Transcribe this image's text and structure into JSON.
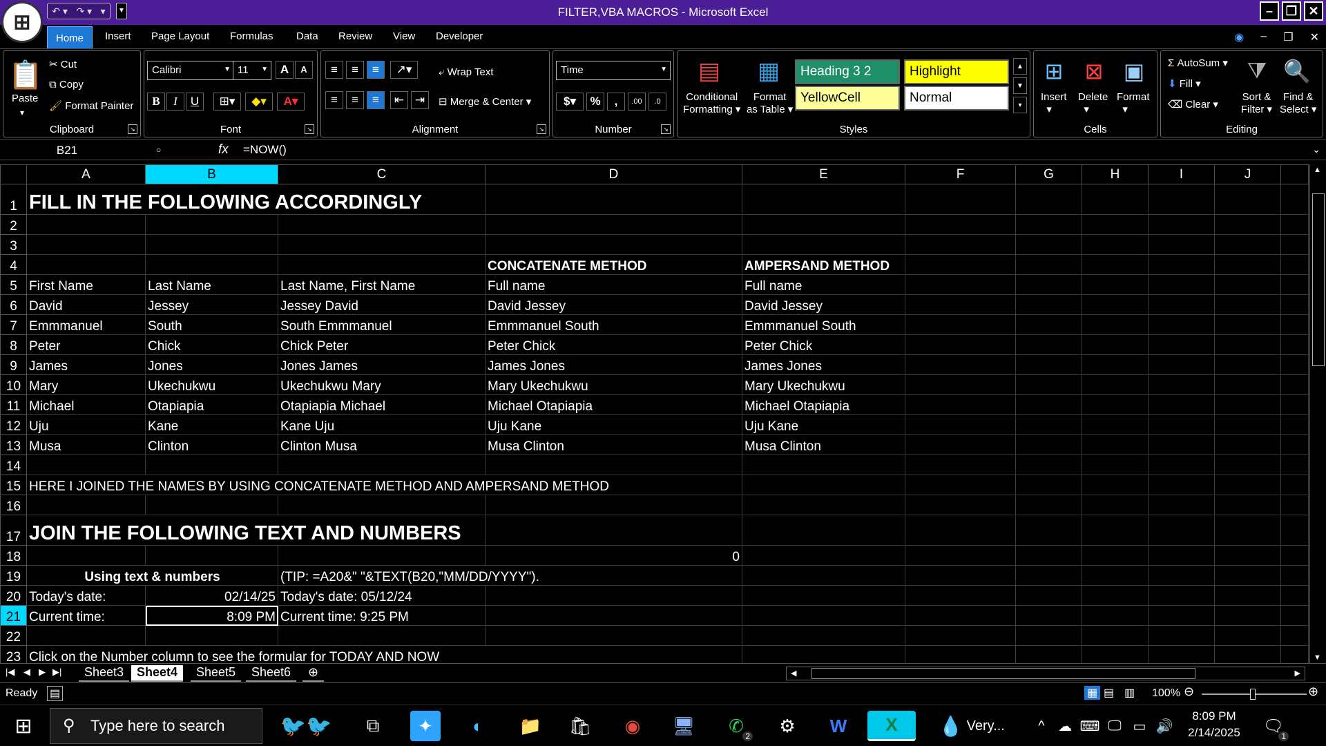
{
  "window": {
    "title": "FILTER,VBA MACROS - Microsoft Excel",
    "controls": [
      "minimize",
      "restore",
      "close"
    ]
  },
  "ribbon_tabs": [
    "Home",
    "Insert",
    "Page Layout",
    "Formulas",
    "Data",
    "Review",
    "View",
    "Developer"
  ],
  "active_tab": "Home",
  "clipboard": {
    "paste": "Paste",
    "cut": "Cut",
    "copy": "Copy",
    "format_painter": "Format Painter",
    "label": "Clipboard"
  },
  "font": {
    "name": "Calibri",
    "size": "11",
    "label": "Font"
  },
  "alignment": {
    "wrap_text": "Wrap Text",
    "merge_center": "Merge & Center",
    "label": "Alignment"
  },
  "number": {
    "format": "Time",
    "label": "Number"
  },
  "styles": {
    "conditional_formatting_1": "Conditional",
    "conditional_formatting_2": "Formatting",
    "format_as_table_1": "Format",
    "format_as_table_2": "as Table",
    "gallery": [
      {
        "name": "Heading 3 2",
        "bg": "#1f8f6a",
        "fg": "#ffffff"
      },
      {
        "name": "Highlight",
        "bg": "#ffff00",
        "fg": "#000000"
      },
      {
        "name": "YellowCell",
        "bg": "#ffff99",
        "fg": "#000000"
      },
      {
        "name": "Normal",
        "bg": "#ffffff",
        "fg": "#000000"
      }
    ],
    "label": "Styles"
  },
  "cells": {
    "insert": "Insert",
    "delete": "Delete",
    "format": "Format",
    "label": "Cells"
  },
  "editing": {
    "autosum": "AutoSum",
    "fill": "Fill",
    "clear": "Clear",
    "sort_filter_1": "Sort &",
    "sort_filter_2": "Filter",
    "find_select_1": "Find &",
    "find_select_2": "Select",
    "label": "Editing"
  },
  "formula_bar": {
    "name_box": "B21",
    "fx": "fx",
    "formula": "=NOW()"
  },
  "columns": [
    "A",
    "B",
    "C",
    "D",
    "E",
    "F",
    "G",
    "H",
    "I",
    "J"
  ],
  "selected_column": "B",
  "selected_row": "21",
  "rows": [
    {
      "n": "1",
      "big": true,
      "A": "FILL IN THE FOLLOWING ACCORDINGLY"
    },
    {
      "n": "2"
    },
    {
      "n": "3"
    },
    {
      "n": "4",
      "D": "CONCATENATE METHOD",
      "E": "AMPERSAND METHOD",
      "bold_de": true
    },
    {
      "n": "5",
      "A": "First Name",
      "B": "Last Name",
      "C": "Last Name, First Name",
      "D": "Full name",
      "E": "Full name"
    },
    {
      "n": "6",
      "A": "David",
      "B": "Jessey",
      "C": "Jessey David",
      "D": "David Jessey",
      "E": "David Jessey"
    },
    {
      "n": "7",
      "A": "Emmmanuel",
      "B": "South",
      "C": "South Emmmanuel",
      "D": "Emmmanuel South",
      "E": "Emmmanuel South"
    },
    {
      "n": "8",
      "A": "Peter",
      "B": "Chick",
      "C": "Chick Peter",
      "D": "Peter Chick",
      "E": "Peter Chick"
    },
    {
      "n": "9",
      "A": "James",
      "B": "Jones",
      "C": "Jones James",
      "D": "James Jones",
      "E": "James Jones"
    },
    {
      "n": "10",
      "A": "Mary",
      "B": "Ukechukwu",
      "C": "Ukechukwu Mary",
      "D": "Mary Ukechukwu",
      "E": "Mary Ukechukwu"
    },
    {
      "n": "11",
      "A": "Michael",
      "B": "Otapiapia",
      "C": "Otapiapia Michael",
      "D": "Michael Otapiapia",
      "E": "Michael Otapiapia"
    },
    {
      "n": "12",
      "A": "Uju",
      "B": "Kane",
      "C": "Kane Uju",
      "D": "Uju Kane",
      "E": "Uju Kane"
    },
    {
      "n": "13",
      "A": "Musa",
      "B": "Clinton",
      "C": "Clinton Musa",
      "D": "Musa Clinton",
      "E": "Musa Clinton"
    },
    {
      "n": "14"
    },
    {
      "n": "15",
      "A": "HERE I JOINED THE NAMES BY USING CONCATENATE METHOD AND AMPERSAND METHOD",
      "span": 4
    },
    {
      "n": "16"
    },
    {
      "n": "17",
      "big": true,
      "A": "JOIN THE FOLLOWING TEXT AND NUMBERS"
    },
    {
      "n": "18",
      "D": "0",
      "right_d": true
    },
    {
      "n": "19",
      "AB": "Using text & numbers",
      "C": "(TIP: =A20&\" \"&TEXT(B20,\"MM/DD/YYYY\").",
      "span_c": 2
    },
    {
      "n": "20",
      "A": "Today's date:",
      "B": "02/14/25",
      "C": "Today's date: 05/12/24",
      "right_b": true
    },
    {
      "n": "21",
      "A": "Current time:",
      "B": "8:09 PM",
      "C": "Current time: 9:25 PM",
      "right_b": true,
      "active_b": true
    },
    {
      "n": "22"
    },
    {
      "n": "23",
      "A": "Click on the Number column to see the formular for TODAY AND NOW",
      "span": 4
    }
  ],
  "sheets": [
    "Sheet3",
    "Sheet4",
    "Sheet5",
    "Sheet6"
  ],
  "active_sheet": "Sheet4",
  "status": {
    "ready": "Ready",
    "zoom": "100%"
  },
  "taskbar": {
    "search_placeholder": "Type here to search",
    "weather": "Very...",
    "time": "8:09 PM",
    "date": "2/14/2025",
    "whatsapp_badge": "2",
    "notification_badge": "1"
  }
}
